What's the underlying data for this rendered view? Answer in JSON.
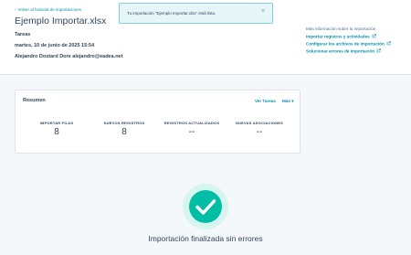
{
  "header": {
    "back_link": "Volver al historial de importaciones",
    "title": "Ejemplo Importar.xlsx",
    "type": "Tareas",
    "date": "martes, 10 de junio de 2025 15:54",
    "user": "Alejandro Dostard Dore alejandro@eadea.net"
  },
  "toast": {
    "message": "Tu importación \"Ejemplo Importar.xlsx\" está lista.",
    "close": "×"
  },
  "more_info": {
    "title": "Más información sobre la importación",
    "links": [
      "Importar registros y actividades",
      "Configurar los archivos de importación",
      "Solucionar errores de importación"
    ]
  },
  "summary": {
    "title": "Resumen",
    "view_tasks": "Ver Tareas",
    "more": "Más",
    "stats": [
      {
        "label": "IMPORTAR FILAS",
        "value": "8"
      },
      {
        "label": "NUEVOS REGISTROS",
        "value": "8"
      },
      {
        "label": "REGISTROS ACTUALIZADOS",
        "value": "--"
      },
      {
        "label": "NUEVAS ASOCIACIONES",
        "value": "--"
      }
    ]
  },
  "result": {
    "message": "Importación finalizada sin errores"
  },
  "colors": {
    "accent_link": "#0091ae",
    "success": "#00bda5",
    "text": "#33475b",
    "toast_bg": "#e5f5f8"
  }
}
